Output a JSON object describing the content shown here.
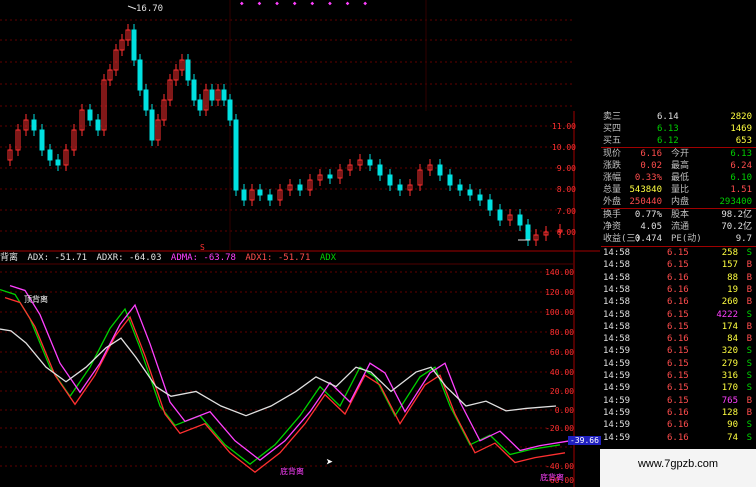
{
  "top_menu": {
    "title": "",
    "marks": [
      "◆",
      "◆",
      "◆",
      "◆",
      "◆",
      "◆",
      "◆",
      "◆"
    ]
  },
  "kline": {
    "max_label": "16.70",
    "price_axis": [
      "11.00",
      "10.00",
      "9.00",
      "8.00",
      "7.00",
      "6.00"
    ],
    "marker_s": "S",
    "colors": {
      "up": "#ff3030",
      "down": "#00e0e0",
      "grid": "#600000"
    }
  },
  "indicator": {
    "name": "背离",
    "adx_label": "ADX: -51.71",
    "adxr_label": "ADXR: -64.03",
    "adma_label": "ADMA: -63.78",
    "adx1_label": "ADX1: -51.71",
    "adx_tail": "ADX",
    "axis": [
      "140.00",
      "120.00",
      "100.00",
      "80.00",
      "60.00",
      "40.00",
      "20.00",
      "0.00",
      "-20.00",
      "-40.00",
      "-60.00"
    ],
    "current_value": "-39.66",
    "top_div_label": "顶背离",
    "bottom_div_label": "底背离"
  },
  "quote": {
    "asks": [
      {
        "label": "卖三",
        "price": "6.14",
        "vol": "2820"
      },
      {
        "label": "买四",
        "price": "6.13",
        "vol": "1469"
      },
      {
        "label": "买五",
        "price": "6.12",
        "vol": "653"
      }
    ],
    "stats": [
      {
        "l1": "现价",
        "v1": "6.16",
        "c1": "red",
        "l2": "今开",
        "v2": "6.13",
        "c2": "green"
      },
      {
        "l1": "涨跌",
        "v1": "0.02",
        "c1": "red",
        "l2": "最高",
        "v2": "6.24",
        "c2": "red"
      },
      {
        "l1": "涨幅",
        "v1": "0.33%",
        "c1": "red",
        "l2": "最低",
        "v2": "6.10",
        "c2": "green"
      },
      {
        "l1": "总量",
        "v1": "543840",
        "c1": "yellow",
        "l2": "量比",
        "v2": "1.51",
        "c2": "red"
      },
      {
        "l1": "外盘",
        "v1": "250440",
        "c1": "red",
        "l2": "内盘",
        "v2": "293400",
        "c2": "green"
      }
    ],
    "stats2": [
      {
        "l1": "换手",
        "v1": "0.77%",
        "l2": "股本",
        "v2": "98.2亿"
      },
      {
        "l1": "净资",
        "v1": "4.05",
        "l2": "流通",
        "v2": "70.2亿"
      },
      {
        "l1": "收益(三)",
        "v1": "0.474",
        "l2": "PE(动)",
        "v2": "9.7"
      }
    ],
    "ticks": [
      {
        "t": "14:58",
        "p": "6.15",
        "v": "258",
        "s": "S",
        "vc": "yellow"
      },
      {
        "t": "14:58",
        "p": "6.15",
        "v": "157",
        "s": "B",
        "vc": "yellow"
      },
      {
        "t": "14:58",
        "p": "6.16",
        "v": "88",
        "s": "B",
        "vc": "yellow"
      },
      {
        "t": "14:58",
        "p": "6.16",
        "v": "19",
        "s": "B",
        "vc": "yellow"
      },
      {
        "t": "14:58",
        "p": "6.16",
        "v": "260",
        "s": "B",
        "vc": "yellow"
      },
      {
        "t": "14:58",
        "p": "6.15",
        "v": "4222",
        "s": "S",
        "vc": "magenta"
      },
      {
        "t": "14:58",
        "p": "6.15",
        "v": "174",
        "s": "B",
        "vc": "yellow"
      },
      {
        "t": "14:58",
        "p": "6.16",
        "v": "84",
        "s": "B",
        "vc": "yellow"
      },
      {
        "t": "14:59",
        "p": "6.15",
        "v": "320",
        "s": "S",
        "vc": "yellow"
      },
      {
        "t": "14:59",
        "p": "6.15",
        "v": "279",
        "s": "S",
        "vc": "yellow"
      },
      {
        "t": "14:59",
        "p": "6.15",
        "v": "316",
        "s": "S",
        "vc": "yellow"
      },
      {
        "t": "14:59",
        "p": "6.15",
        "v": "170",
        "s": "S",
        "vc": "yellow"
      },
      {
        "t": "14:59",
        "p": "6.15",
        "v": "765",
        "s": "B",
        "vc": "magenta"
      },
      {
        "t": "14:59",
        "p": "6.16",
        "v": "128",
        "s": "B",
        "vc": "yellow"
      },
      {
        "t": "14:59",
        "p": "6.16",
        "v": "90",
        "s": "S",
        "vc": "yellow"
      },
      {
        "t": "14:59",
        "p": "6.16",
        "v": "74",
        "s": "S",
        "vc": "yellow"
      }
    ]
  },
  "watermark": "www.7gpzb.com"
}
